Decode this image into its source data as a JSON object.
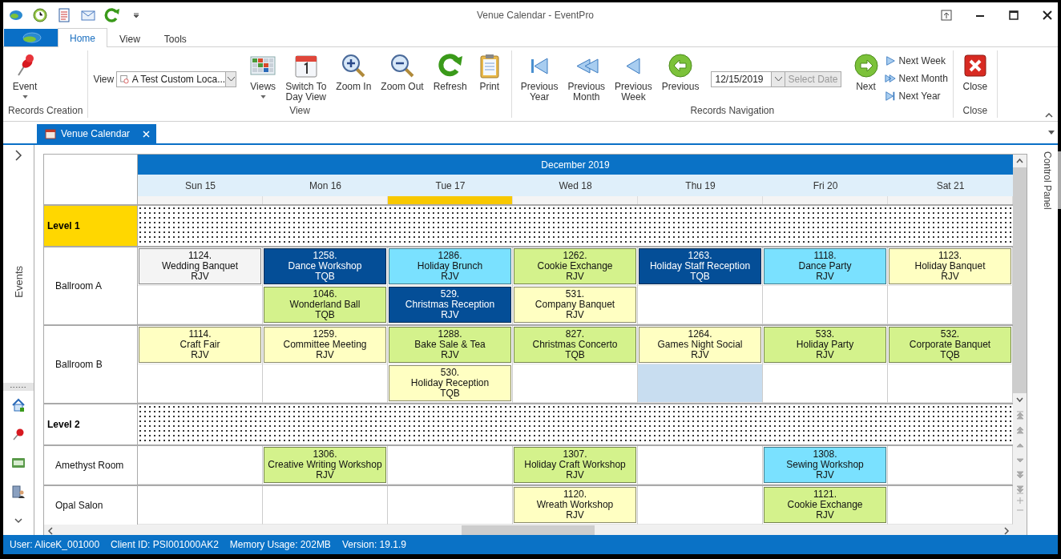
{
  "window": {
    "title": "Venue Calendar - EventPro"
  },
  "ribbon_tabs": [
    {
      "label": "Home",
      "selected": true
    },
    {
      "label": "View",
      "selected": false
    },
    {
      "label": "Tools",
      "selected": false
    }
  ],
  "ribbon": {
    "groups": [
      {
        "label": "Records Creation",
        "controls": [
          {
            "kind": "large",
            "label": "Event",
            "dropdown": true
          }
        ]
      },
      {
        "label": "View",
        "controls": [
          {
            "kind": "combo",
            "label": "View",
            "value": "A Test Custom Loca..."
          },
          {
            "kind": "large",
            "label": "Views",
            "dropdown": true
          },
          {
            "kind": "large",
            "label": "Switch To\nDay View",
            "dropdown": false
          },
          {
            "kind": "large",
            "label": "Zoom In",
            "dropdown": false
          },
          {
            "kind": "large",
            "label": "Zoom Out",
            "dropdown": false
          },
          {
            "kind": "large",
            "label": "Refresh",
            "dropdown": false
          },
          {
            "kind": "large",
            "label": "Print",
            "dropdown": false
          }
        ]
      },
      {
        "label": "Records Navigation",
        "controls": [
          {
            "kind": "large",
            "label": "Previous\nYear",
            "dropdown": false
          },
          {
            "kind": "large",
            "label": "Previous\nMonth",
            "dropdown": false
          },
          {
            "kind": "large",
            "label": "Previous\nWeek",
            "dropdown": false
          },
          {
            "kind": "large",
            "label": "Previous",
            "dropdown": false
          },
          {
            "kind": "date",
            "value": "12/15/2019",
            "button": "Select Date",
            "disabled": true
          },
          {
            "kind": "large",
            "label": "Next",
            "dropdown": false
          },
          {
            "kind": "stack",
            "items": [
              "Next Week",
              "Next Month",
              "Next Year"
            ]
          }
        ]
      },
      {
        "label": "Close",
        "controls": [
          {
            "kind": "large",
            "label": "Close",
            "dropdown": false
          }
        ]
      }
    ]
  },
  "doc_tabs": [
    {
      "label": "Venue Calendar",
      "selected": true
    }
  ],
  "sidebar": {
    "label": "Events"
  },
  "right_panel": {
    "label": "Control Panel"
  },
  "calendar": {
    "month": "December 2019",
    "days": [
      {
        "label": "Sun 15",
        "today": false
      },
      {
        "label": "Mon 16",
        "today": false
      },
      {
        "label": "Tue 17",
        "today": true
      },
      {
        "label": "Wed 18",
        "today": false
      },
      {
        "label": "Thu 19",
        "today": false
      },
      {
        "label": "Fri 20",
        "today": false
      },
      {
        "label": "Sat 21",
        "today": false
      }
    ],
    "groups": [
      {
        "name": "Level 1",
        "selected": true,
        "rooms": [
          {
            "name": "Ballroom A",
            "lanes": [
              [
                {
                  "kind": "event",
                  "number": "1124.",
                  "title": "Wedding Banquet",
                  "code": "RJV",
                  "color": "#f4f4f4"
                },
                {
                  "kind": "event",
                  "number": "1258.",
                  "title": "Dance Workshop",
                  "code": "TQB",
                  "color": "#044e97"
                },
                {
                  "kind": "event",
                  "number": "1286.",
                  "title": "Holiday Brunch",
                  "code": "RJV",
                  "color": "#7ae1ff"
                },
                {
                  "kind": "event",
                  "number": "1262.",
                  "title": "Cookie Exchange",
                  "code": "RJV",
                  "color": "#d4f28c"
                },
                {
                  "kind": "event",
                  "number": "1263.",
                  "title": "Holiday Staff Reception",
                  "code": "TQB",
                  "color": "#044e97"
                },
                {
                  "kind": "event",
                  "number": "1118.",
                  "title": "Dance Party",
                  "code": "RJV",
                  "color": "#7ae1ff"
                },
                {
                  "kind": "event",
                  "number": "1123.",
                  "title": "Holiday Banquet",
                  "code": "RJV",
                  "color": "#ffffc2"
                }
              ],
              [
                {
                  "kind": "empty",
                  "selected": false
                },
                {
                  "kind": "event",
                  "number": "1046.",
                  "title": "Wonderland Ball",
                  "code": "TQB",
                  "color": "#d4f28c"
                },
                {
                  "kind": "event",
                  "number": "529.",
                  "title": "Christmas Reception",
                  "code": "RJV",
                  "color": "#044e97"
                },
                {
                  "kind": "event",
                  "number": "531.",
                  "title": "Company Banquet",
                  "code": "RJV",
                  "color": "#ffffc2"
                },
                {
                  "kind": "empty",
                  "selected": false
                },
                {
                  "kind": "empty",
                  "selected": false
                },
                {
                  "kind": "empty",
                  "selected": false
                }
              ]
            ]
          },
          {
            "name": "Ballroom B",
            "lanes": [
              [
                {
                  "kind": "event",
                  "number": "1114.",
                  "title": "Craft Fair",
                  "code": "RJV",
                  "color": "#ffffc2"
                },
                {
                  "kind": "event",
                  "number": "1259.",
                  "title": "Committee Meeting",
                  "code": "RJV",
                  "color": "#ffffc2"
                },
                {
                  "kind": "event",
                  "number": "1288.",
                  "title": "Bake Sale & Tea",
                  "code": "RJV",
                  "color": "#d4f28c"
                },
                {
                  "kind": "event",
                  "number": "827.",
                  "title": "Christmas Concerto",
                  "code": "TQB",
                  "color": "#d4f28c"
                },
                {
                  "kind": "event",
                  "number": "1264.",
                  "title": "Games Night Social",
                  "code": "RJV",
                  "color": "#ffffc2"
                },
                {
                  "kind": "event",
                  "number": "533.",
                  "title": "Holiday Party",
                  "code": "RJV",
                  "color": "#d4f28c"
                },
                {
                  "kind": "event",
                  "number": "532.",
                  "title": "Corporate Banquet",
                  "code": "TQB",
                  "color": "#d4f28c"
                }
              ],
              [
                {
                  "kind": "empty",
                  "selected": false
                },
                {
                  "kind": "empty",
                  "selected": false
                },
                {
                  "kind": "event",
                  "number": "530.",
                  "title": "Holiday Reception",
                  "code": "TQB",
                  "color": "#ffffc2"
                },
                {
                  "kind": "empty",
                  "selected": false
                },
                {
                  "kind": "empty",
                  "selected": true
                },
                {
                  "kind": "empty",
                  "selected": false
                },
                {
                  "kind": "empty",
                  "selected": false
                }
              ]
            ]
          }
        ]
      },
      {
        "name": "Level 2",
        "selected": false,
        "rooms": [
          {
            "name": "Amethyst Room",
            "lanes": [
              [
                {
                  "kind": "empty",
                  "selected": false
                },
                {
                  "kind": "event",
                  "number": "1306.",
                  "title": "Creative Writing Workshop",
                  "code": "RJV",
                  "color": "#d4f28c"
                },
                {
                  "kind": "empty",
                  "selected": false
                },
                {
                  "kind": "event",
                  "number": "1307.",
                  "title": "Holiday Craft Workshop",
                  "code": "RJV",
                  "color": "#d4f28c"
                },
                {
                  "kind": "empty",
                  "selected": false
                },
                {
                  "kind": "event",
                  "number": "1308.",
                  "title": "Sewing Workshop",
                  "code": "RJV",
                  "color": "#7ae1ff"
                },
                {
                  "kind": "empty",
                  "selected": false
                }
              ]
            ]
          },
          {
            "name": "Opal Salon",
            "lanes": [
              [
                {
                  "kind": "empty",
                  "selected": false
                },
                {
                  "kind": "empty",
                  "selected": false
                },
                {
                  "kind": "empty",
                  "selected": false
                },
                {
                  "kind": "event",
                  "number": "1120.",
                  "title": "Wreath Workshop",
                  "code": "RJV",
                  "color": "#ffffc2"
                },
                {
                  "kind": "empty",
                  "selected": false
                },
                {
                  "kind": "event",
                  "number": "1121.",
                  "title": "Cookie Exchange",
                  "code": "RJV",
                  "color": "#d4f28c"
                },
                {
                  "kind": "empty",
                  "selected": false
                }
              ]
            ]
          }
        ]
      }
    ]
  },
  "status_bar": [
    "User: AliceK_001000",
    "Client ID: PSI001000AK2",
    "Memory Usage: 202MB",
    "Version: 19.1.9"
  ]
}
